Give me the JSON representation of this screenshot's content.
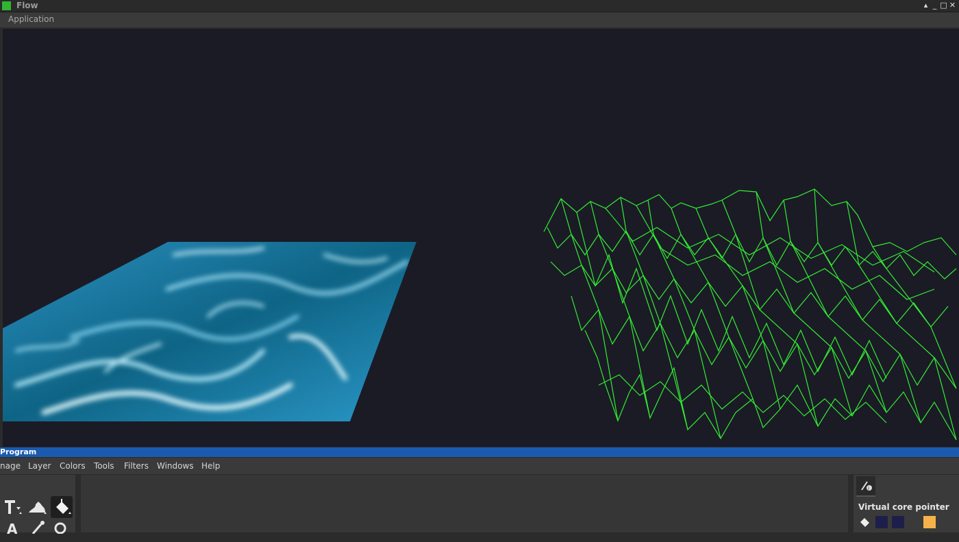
{
  "window": {
    "title": "Flow",
    "controls": {
      "minimize": "▴",
      "iconify": "_",
      "maximize": "□",
      "close": "✕"
    }
  },
  "app_menu": {
    "label": "Application"
  },
  "viewport": {
    "background": "#1b1b26",
    "water_colors": [
      "#0e6485",
      "#3aa7d6",
      "#e6fbff"
    ],
    "wireframe_color": "#33ee33"
  },
  "program": {
    "title": "Program",
    "menu": [
      "nage",
      "Layer",
      "Colors",
      "Tools",
      "Filters",
      "Windows",
      "Help"
    ]
  },
  "toolbox": {
    "tools": [
      "transform-icon",
      "smudge-icon",
      "bucket-fill-icon",
      "text-icon",
      "color-picker-icon",
      "magnify-icon"
    ]
  },
  "right_panel": {
    "tab_icon": "device-status-icon",
    "heading": "Virtual core pointer",
    "swatches": [
      "#1e1e4a",
      "#1e1e4a",
      "#f6b24a"
    ]
  }
}
